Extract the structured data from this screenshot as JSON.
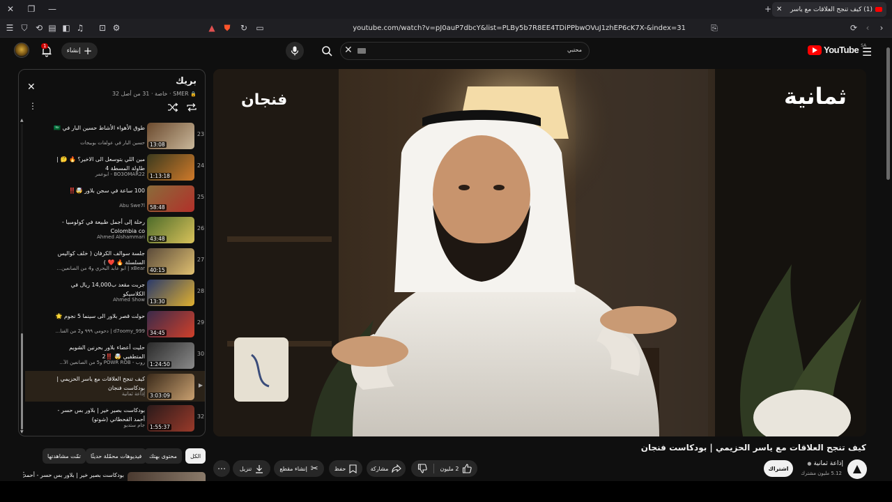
{
  "browser": {
    "tab_title": "(1) كيف تنجح العلاقات مع ياسر",
    "url": "youtube.com/watch?v=pJ0auP7dbcY&list=PLBy5b7R8EE4TDiPPbwOVuJ1zhEP6cK7X-&index=31"
  },
  "header": {
    "logo_text": "YouTube",
    "country": "SA",
    "search_value": "محتبي",
    "create_label": "إنشاء",
    "notification_count": "1"
  },
  "playlist": {
    "title": "بريك",
    "subtitle": "SMER · خاصة · 31 من أصل 32",
    "items": [
      {
        "index": "23",
        "title": "طوق الأهواء الأشاط حسين البار في 🇸🇦",
        "channel": "حسين البار في عولفات بوبيجات",
        "duration": "13:08",
        "colors": [
          "#6b4a2e",
          "#c9b79a"
        ]
      },
      {
        "index": "24",
        "title": "مين اللي بتوسعل الى الاخير؟ 🔥 🤔 | طاولة المسطة 4",
        "channel": "BO3OMAR22 - ابوعمر",
        "duration": "1:13:18",
        "colors": [
          "#3b3a1e",
          "#d07a2a"
        ]
      },
      {
        "index": "25",
        "title": "100 ساعة في سجن بلاور 🤯‼️",
        "channel": "Abu Swe7l",
        "duration": "58:48",
        "colors": [
          "#8a6c3a",
          "#b2302a"
        ]
      },
      {
        "index": "26",
        "title": "رحلة إلى أجمل طبيعة في كولومبيا - Colombia co",
        "channel": "Ahmed Alshammari",
        "duration": "43:48",
        "colors": [
          "#4d6b2a",
          "#d9c25a"
        ]
      },
      {
        "index": "27",
        "title": "جلسة سوالف الكرفان ( خلف كواليس السلسلة 🔥 ❤️ )",
        "channel": "xBear | ابو عابد البحري و4 من الصانعين...",
        "duration": "40:15",
        "colors": [
          "#5a4a3a",
          "#e0c070"
        ]
      },
      {
        "index": "28",
        "title": "جربت مقعد ب14,000 ريال في الكلاسيكو",
        "channel": "Ahmed Show",
        "duration": "13:30",
        "colors": [
          "#2a3a6b",
          "#e0b030"
        ]
      },
      {
        "index": "29",
        "title": "حولت قصر بلاور الى سينما 5 نجوم 🌟",
        "channel": "d7oomy_999 | دحومي ٩٩٩ و2 من الفنا...",
        "duration": "34:45",
        "colors": [
          "#3a2a4a",
          "#d0402a"
        ]
      },
      {
        "index": "30",
        "title": "حليت أعضاء بلاور بحرنين الشويم المتطفيي 🤯 ‼️2",
        "channel": "روب - POWR ROB و5 من الصانعين الآ...",
        "duration": "1:24:50",
        "colors": [
          "#2a2a2a",
          "#8a8a8a"
        ]
      },
      {
        "index": "▶",
        "title": "كيف تنجح العلاقات مع ياسر الحزيمي | بودكاست فنجان",
        "channel": "إذاعة ثمانية",
        "duration": "3:03:09",
        "colors": [
          "#3a2a1a",
          "#c9a070"
        ]
      },
      {
        "index": "32",
        "title": "بودكاست بصير خير | بلاور بس حسر - أحمد القحطاني (شوتو)",
        "channel": "جام ستديو",
        "duration": "1:55:37",
        "colors": [
          "#2a1a1a",
          "#9a3a2a"
        ]
      }
    ]
  },
  "video": {
    "logo_right": "ثمانية",
    "logo_left": "فنجان",
    "title": "كيف تنجح العلاقات مع ياسر الحزيمي | بودكاست فنجان"
  },
  "channel": {
    "name": "إذاعة ثمانية",
    "subscribers": "5.12 مليون مشترك",
    "subscribe_label": "اشتراك"
  },
  "actions": {
    "likes": "2 مليون",
    "share": "مشاركة",
    "save": "حفظ",
    "clip": "إنشاء مقطع",
    "download": "تنزيل"
  },
  "chips": [
    {
      "label": "الكل",
      "selected": true
    },
    {
      "label": "محتوى بهتك",
      "selected": false
    },
    {
      "label": "فيديوهات محمّلة حديثًا",
      "selected": false
    },
    {
      "label": "تمّت مشاهدتها",
      "selected": false
    }
  ],
  "next_video_title": "بودكاست بصير خير | بلاور بس حسر - أحمد"
}
